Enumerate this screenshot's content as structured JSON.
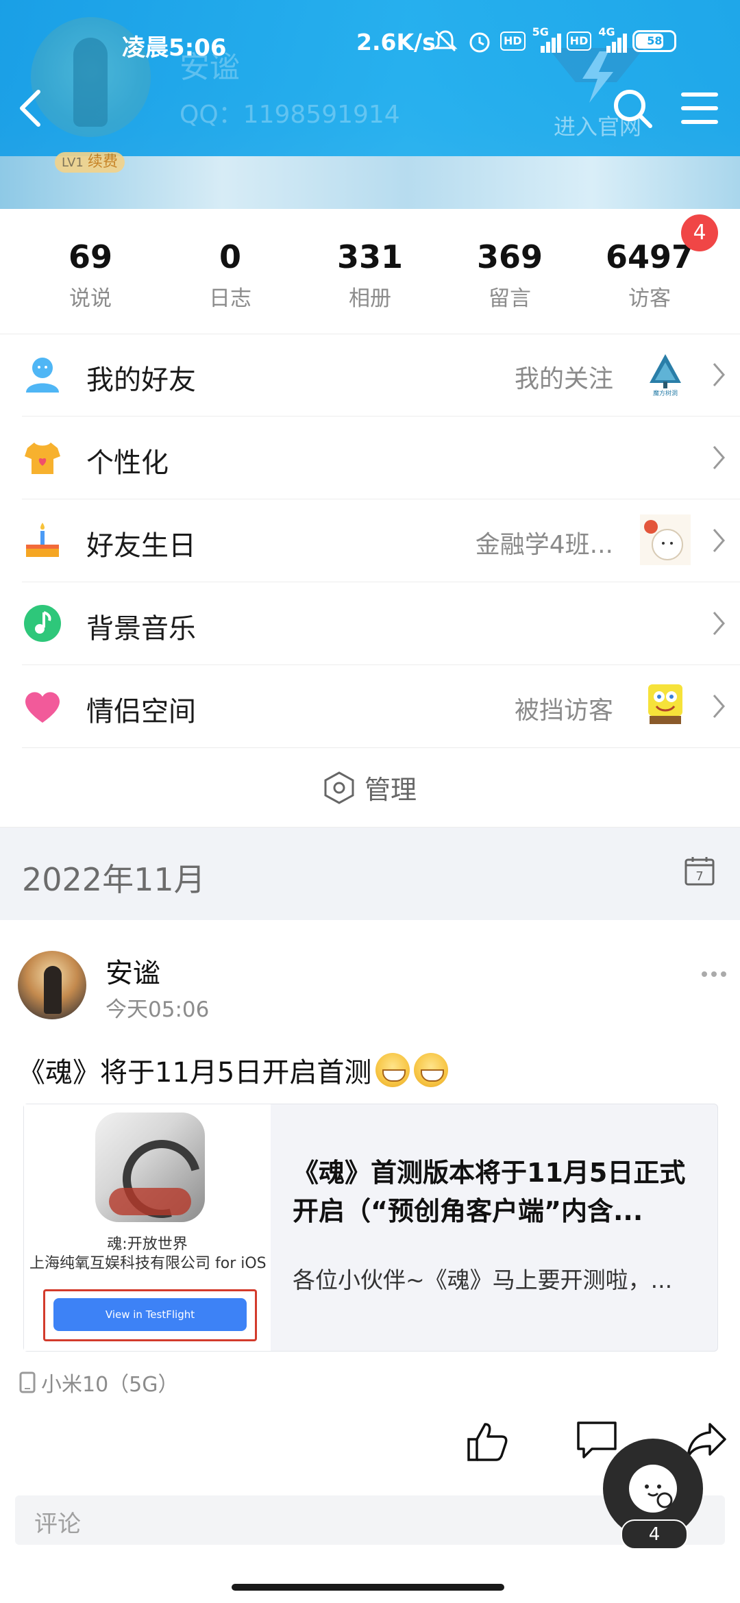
{
  "status_bar": {
    "time": "凌晨5:06",
    "net_speed": "2.6K/s",
    "hd1": "HD",
    "net1": "5G",
    "hd2": "HD",
    "net2": "4G",
    "battery": "58"
  },
  "header": {
    "profile_name": "安谧",
    "qq_line": "QQ：1198591914",
    "level": "LV1",
    "renew_label": "续费",
    "official_label": "进入官网"
  },
  "stats": [
    {
      "value": "69",
      "label": "说说"
    },
    {
      "value": "0",
      "label": "日志"
    },
    {
      "value": "331",
      "label": "相册"
    },
    {
      "value": "369",
      "label": "留言"
    },
    {
      "value": "6497",
      "label": "访客",
      "badge": "4"
    }
  ],
  "menu": [
    {
      "title": "我的好友",
      "sub": "我的关注",
      "icon": "friends-icon",
      "thumb": "tree-thumb"
    },
    {
      "title": "个性化",
      "sub": "",
      "icon": "tshirt-icon",
      "thumb": ""
    },
    {
      "title": "好友生日",
      "sub": "金融学4班...",
      "icon": "cake-icon",
      "thumb": "cat-thumb"
    },
    {
      "title": "背景音乐",
      "sub": "",
      "icon": "music-icon",
      "thumb": ""
    },
    {
      "title": "情侣空间",
      "sub": "被挡访客",
      "icon": "heart-icon",
      "thumb": "sponge-thumb"
    }
  ],
  "manage_label": "管理",
  "date_section": {
    "label": "2022年11月",
    "calendar_day": "7"
  },
  "post": {
    "author": "安谧",
    "time": "今天05:06",
    "text": "《魂》将于11月5日开启首测",
    "card": {
      "app_name": "魂:开放世界",
      "developer": "上海纯氧互娱科技有限公司 for iOS",
      "testflight_button": "View in TestFlight",
      "title": "《魂》首测版本将于11月5日正式开启（“预创角客户端”内含...",
      "desc": "各位小伙伴~《魂》马上要开测啦，..."
    },
    "device": "小米10（5G）",
    "comment_placeholder": "评论"
  },
  "float_count": "4",
  "colors": {
    "accent": "#1aa3e8",
    "badge": "#f04646",
    "testflight": "#3d82f6"
  }
}
